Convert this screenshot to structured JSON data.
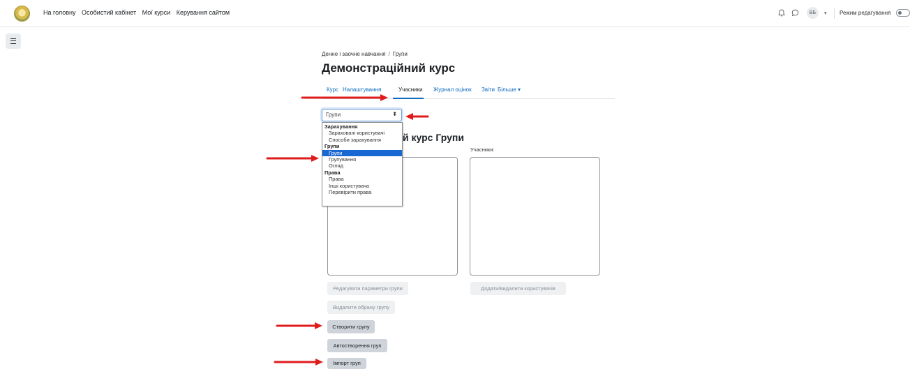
{
  "navbar": {
    "links": [
      "На головну",
      "Особистий кабінет",
      "Мої курси",
      "Керування сайтом"
    ],
    "user_initials": "ВБ",
    "edit_mode_label": "Режим редагування",
    "edit_mode_on": false
  },
  "breadcrumb": {
    "items": [
      "Денне і заочне навчання",
      "Групи"
    ],
    "separator": "/"
  },
  "course": {
    "title": "Демонстраційний курс"
  },
  "tabs": [
    {
      "label": "Курс",
      "active": false
    },
    {
      "label": "Налаштування",
      "active": false
    },
    {
      "label": "Учасники",
      "active": true
    },
    {
      "label": "Журнал оцінок",
      "active": false
    },
    {
      "label": "Звіти",
      "active": false
    },
    {
      "label": "Більше ▾",
      "active": false
    }
  ],
  "select": {
    "value": "Групи",
    "caret": "⬍"
  },
  "dropdown": {
    "groups": [
      {
        "label": "Зарахування",
        "options": [
          "Зараховані користувачі",
          "Способи зарахування"
        ]
      },
      {
        "label": "Групи",
        "options": [
          "Групи",
          "Групування",
          "Огляд"
        ]
      },
      {
        "label": "Права",
        "options": [
          "Права",
          "Інші користувача",
          "Перевірити права"
        ]
      }
    ],
    "selected": "Групи"
  },
  "main": {
    "heading": "й курс Групи",
    "members_label": "Учасники:"
  },
  "buttons": {
    "edit_group": "Редагувати параметри групи",
    "add_remove_users": "Додати/видалити користувачів",
    "delete_group": "Видалити обрану групу",
    "create_group": "Створити групу",
    "auto_create": "Автостворення груп",
    "import_groups": "Імпорт груп"
  },
  "colors": {
    "link": "#0f6cbf",
    "selected_option": "#1967d2",
    "annotation_arrow": "#e01b1b"
  },
  "icons": [
    "bell-icon",
    "chat-icon",
    "chevron-down-icon",
    "drawer-toggle-icon",
    "select-caret-icon"
  ]
}
